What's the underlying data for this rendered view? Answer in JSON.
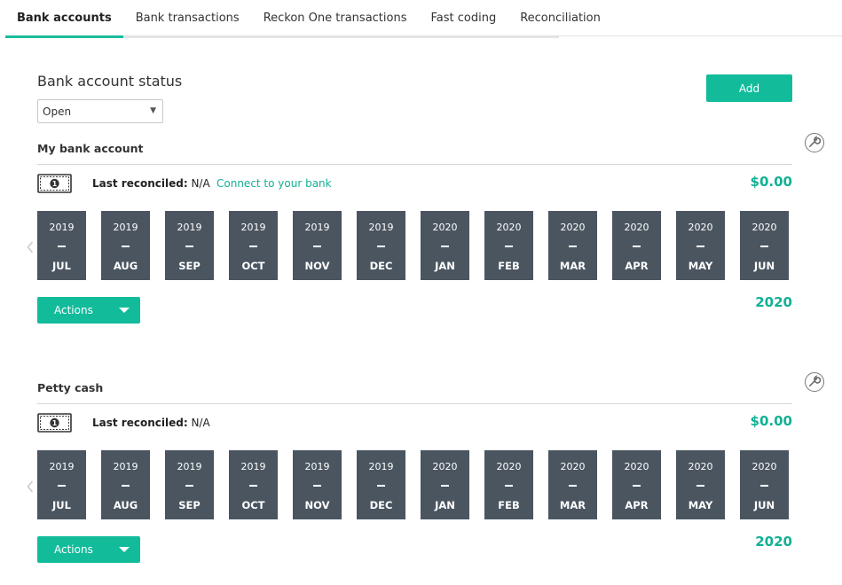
{
  "tabs": [
    {
      "label": "Bank accounts"
    },
    {
      "label": "Bank transactions"
    },
    {
      "label": "Reckon One transactions"
    },
    {
      "label": "Fast coding"
    },
    {
      "label": "Reconciliation"
    }
  ],
  "status": {
    "title": "Bank account status",
    "select_value": "Open"
  },
  "add_label": "Add",
  "accounts": [
    {
      "name": "My bank account",
      "last_reconciled_label": "Last reconciled:",
      "last_reconciled_value": "N/A",
      "connect_label": "Connect to your bank",
      "balance": "$0.00",
      "actions_label": "Actions",
      "year": "2020",
      "months": [
        {
          "year": "2019",
          "month": "JUL"
        },
        {
          "year": "2019",
          "month": "AUG"
        },
        {
          "year": "2019",
          "month": "SEP"
        },
        {
          "year": "2019",
          "month": "OCT"
        },
        {
          "year": "2019",
          "month": "NOV"
        },
        {
          "year": "2019",
          "month": "DEC"
        },
        {
          "year": "2020",
          "month": "JAN"
        },
        {
          "year": "2020",
          "month": "FEB"
        },
        {
          "year": "2020",
          "month": "MAR"
        },
        {
          "year": "2020",
          "month": "APR"
        },
        {
          "year": "2020",
          "month": "MAY"
        },
        {
          "year": "2020",
          "month": "JUN"
        }
      ]
    },
    {
      "name": "Petty cash",
      "last_reconciled_label": "Last reconciled:",
      "last_reconciled_value": "N/A",
      "balance": "$0.00",
      "actions_label": "Actions",
      "year": "2020",
      "months": [
        {
          "year": "2019",
          "month": "JUL"
        },
        {
          "year": "2019",
          "month": "AUG"
        },
        {
          "year": "2019",
          "month": "SEP"
        },
        {
          "year": "2019",
          "month": "OCT"
        },
        {
          "year": "2019",
          "month": "NOV"
        },
        {
          "year": "2019",
          "month": "DEC"
        },
        {
          "year": "2020",
          "month": "JAN"
        },
        {
          "year": "2020",
          "month": "FEB"
        },
        {
          "year": "2020",
          "month": "MAR"
        },
        {
          "year": "2020",
          "month": "APR"
        },
        {
          "year": "2020",
          "month": "MAY"
        },
        {
          "year": "2020",
          "month": "JUN"
        }
      ]
    }
  ],
  "colors": {
    "accent": "#12bc9b",
    "month_tile": "#4a5560"
  },
  "icons": {
    "wrench": "wrench-icon",
    "cash": "cash-icon",
    "prev": "chevron-left-icon"
  }
}
